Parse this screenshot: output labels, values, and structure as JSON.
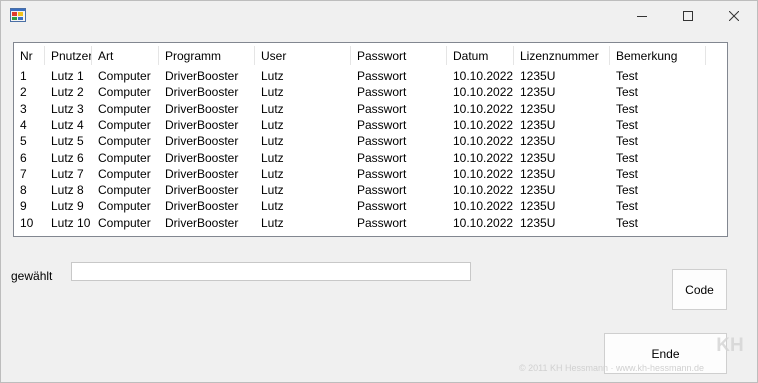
{
  "window": {
    "controls": {
      "minimize_icon": "minimize-icon",
      "maximize_icon": "maximize-icon",
      "close_icon": "close-icon"
    }
  },
  "listview": {
    "columns": [
      "Nr",
      "Pnutzer",
      "Art",
      "Programm",
      "User",
      "Passwort",
      "Datum",
      "Lizenznummer",
      "Bemerkung"
    ],
    "rows": [
      [
        "1",
        "Lutz 1",
        "Computer",
        "DriverBooster",
        "Lutz",
        "Passwort",
        "10.10.2022",
        "1235U",
        "Test"
      ],
      [
        "2",
        "Lutz 2",
        "Computer",
        "DriverBooster",
        "Lutz",
        "Passwort",
        "10.10.2022",
        "1235U",
        "Test"
      ],
      [
        "3",
        "Lutz 3",
        "Computer",
        "DriverBooster",
        "Lutz",
        "Passwort",
        "10.10.2022",
        "1235U",
        "Test"
      ],
      [
        "4",
        "Lutz 4",
        "Computer",
        "DriverBooster",
        "Lutz",
        "Passwort",
        "10.10.2022",
        "1235U",
        "Test"
      ],
      [
        "5",
        "Lutz 5",
        "Computer",
        "DriverBooster",
        "Lutz",
        "Passwort",
        "10.10.2022",
        "1235U",
        "Test"
      ],
      [
        "6",
        "Lutz 6",
        "Computer",
        "DriverBooster",
        "Lutz",
        "Passwort",
        "10.10.2022",
        "1235U",
        "Test"
      ],
      [
        "7",
        "Lutz 7",
        "Computer",
        "DriverBooster",
        "Lutz",
        "Passwort",
        "10.10.2022",
        "1235U",
        "Test"
      ],
      [
        "8",
        "Lutz 8",
        "Computer",
        "DriverBooster",
        "Lutz",
        "Passwort",
        "10.10.2022",
        "1235U",
        "Test"
      ],
      [
        "9",
        "Lutz 9",
        "Computer",
        "DriverBooster",
        "Lutz",
        "Passwort",
        "10.10.2022",
        "1235U",
        "Test"
      ],
      [
        "10",
        "Lutz 10",
        "Computer",
        "DriverBooster",
        "Lutz",
        "Passwort",
        "10.10.2022",
        "1235U",
        "Test"
      ]
    ]
  },
  "selection": {
    "label": "gewählt",
    "value": ""
  },
  "buttons": {
    "code_label": "Code",
    "ende_label": "Ende"
  },
  "watermark": {
    "text": "© 2011 KH Hessmann · www.kh-hessmann.de",
    "logo_text": "KH"
  }
}
